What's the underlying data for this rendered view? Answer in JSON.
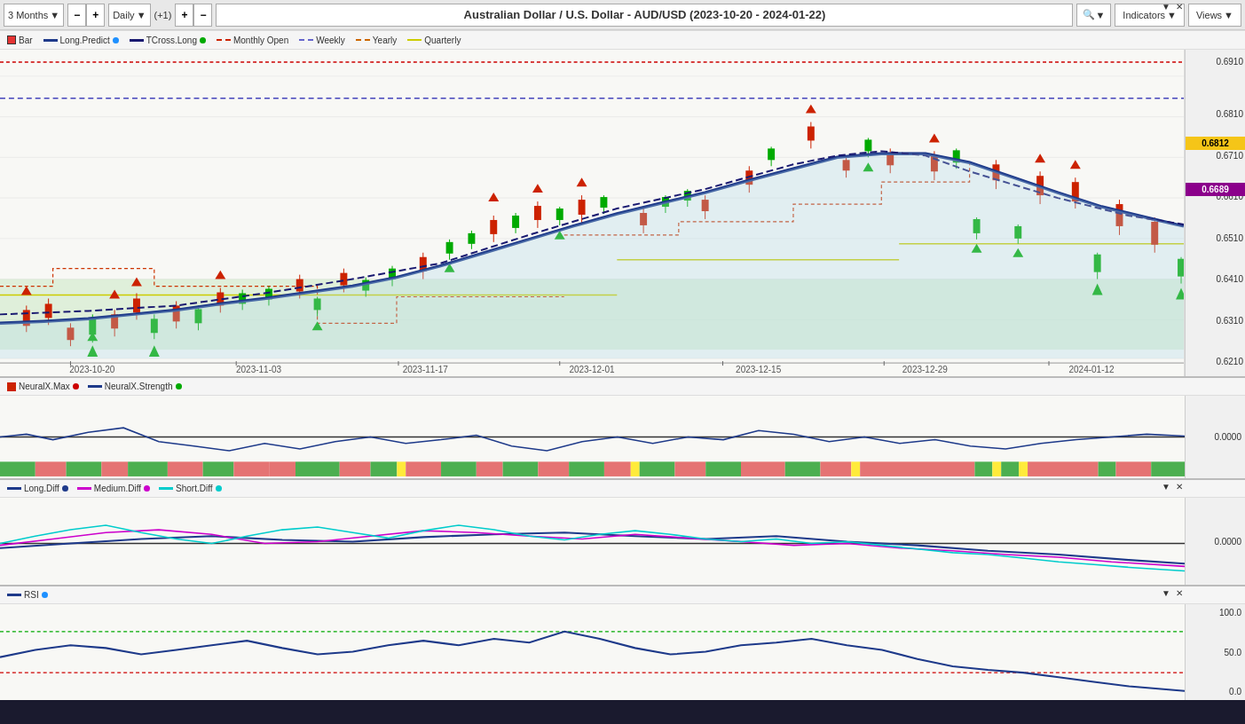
{
  "header": {
    "period": "3 Months",
    "timeframe": "Daily",
    "increment": "(+1)",
    "title": "Australian Dollar / U.S. Dollar - AUD/USD (2023-10-20 - 2024-01-22)",
    "indicators_label": "Indicators",
    "views_label": "Views"
  },
  "legend": {
    "bar_label": "Bar",
    "long_predict_label": "Long.Predict",
    "tcross_long_label": "TCross.Long",
    "monthly_open_label": "Monthly Open",
    "weekly_label": "Weekly",
    "yearly_label": "Yearly",
    "quarterly_label": "Quarterly"
  },
  "price_axis": {
    "labels": [
      "0.6910",
      "0.6810",
      "0.6710",
      "0.6610",
      "0.6510",
      "0.6410",
      "0.6310",
      "0.6210"
    ],
    "current_price": "0.6812",
    "current_price_color": "#f5c518",
    "marker_price": "0.6689",
    "marker_color": "#8b008b"
  },
  "time_axis": {
    "labels": [
      "2023-10-20",
      "2023-11-03",
      "2023-11-17",
      "2023-12-01",
      "2023-12-15",
      "2023-12-29",
      "2024-01-12"
    ]
  },
  "sub_panel1": {
    "legend": {
      "neuralx_max_label": "NeuralX.Max",
      "neuralx_strength_label": "NeuralX.Strength"
    },
    "y_label": "0.0000"
  },
  "sub_panel2": {
    "legend": {
      "long_diff_label": "Long.Diff",
      "medium_diff_label": "Medium.Diff",
      "short_diff_label": "Short.Diff"
    },
    "y_label": "0.0000"
  },
  "sub_panel3": {
    "legend": {
      "rsi_label": "RSI"
    },
    "y_labels": [
      "100.0",
      "50.0",
      "0.0"
    ]
  }
}
